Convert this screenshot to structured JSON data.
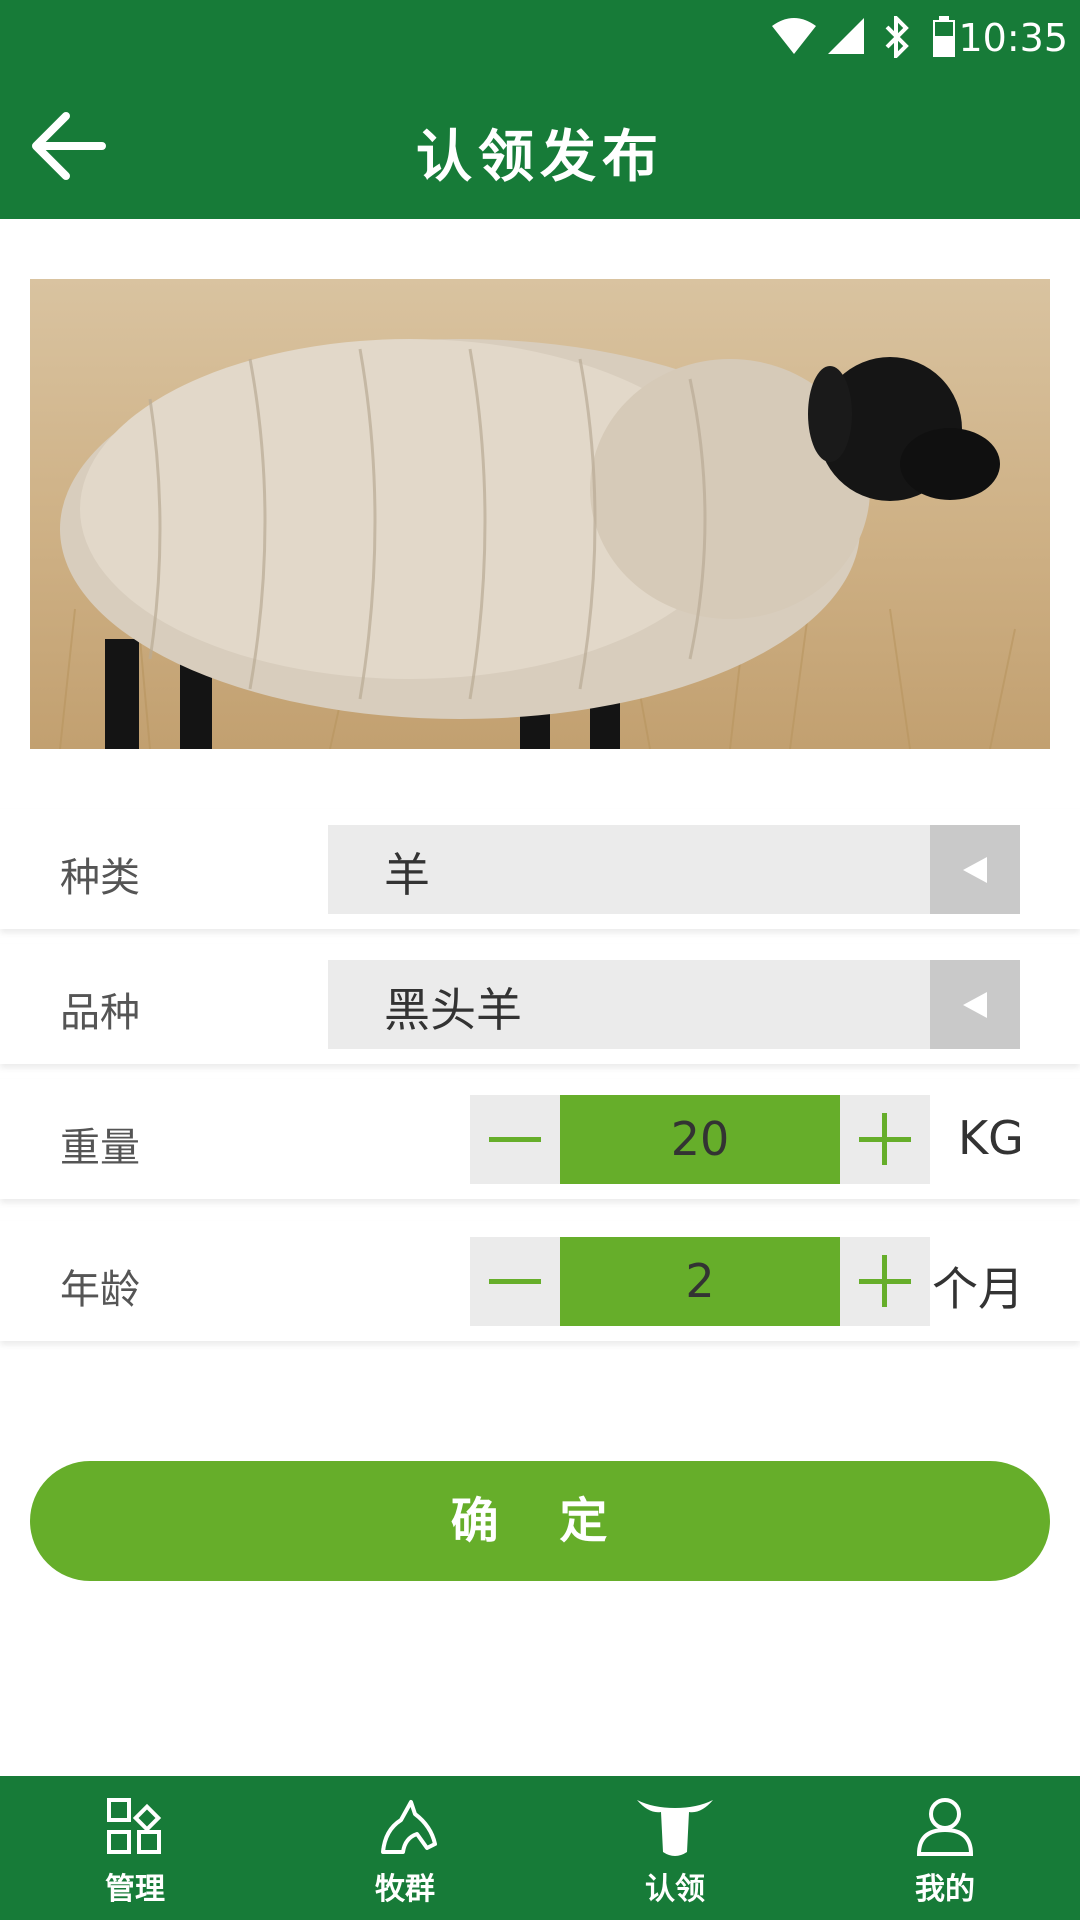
{
  "status_bar": {
    "time": "10:35"
  },
  "header": {
    "title": "认领发布"
  },
  "form": {
    "category": {
      "label": "种类",
      "value": "羊"
    },
    "breed": {
      "label": "品种",
      "value": "黑头羊"
    },
    "weight": {
      "label": "重量",
      "value": "20",
      "unit": "KG"
    },
    "age": {
      "label": "年龄",
      "value": "2",
      "unit": "个月"
    }
  },
  "confirm": {
    "label": "确 定"
  },
  "bottom_nav": {
    "items": [
      {
        "label": "管理",
        "icon": "grid-icon"
      },
      {
        "label": "牧群",
        "icon": "horse-icon"
      },
      {
        "label": "认领",
        "icon": "bull-icon"
      },
      {
        "label": "我的",
        "icon": "user-icon"
      }
    ]
  },
  "colors": {
    "header": "#177b38",
    "accent": "#66ae2a",
    "select_bg": "#ebebeb"
  }
}
